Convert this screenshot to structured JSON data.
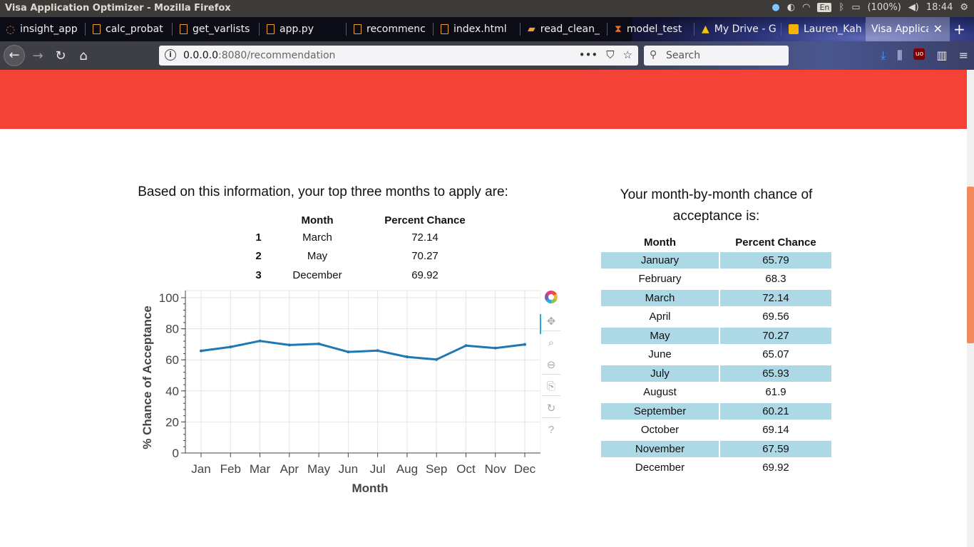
{
  "system": {
    "window_title": "Visa Application Optimizer - Mozilla Firefox",
    "lang": "En",
    "battery": "(100%)",
    "clock": "18:44"
  },
  "tabs": [
    {
      "label": "insight_app",
      "icon": "ubuntu-icon"
    },
    {
      "label": "calc_probat",
      "icon": "file-icon"
    },
    {
      "label": "get_varlists",
      "icon": "file-icon"
    },
    {
      "label": "app.py",
      "icon": "file-icon"
    },
    {
      "label": "recommenc",
      "icon": "file-icon"
    },
    {
      "label": "index.html",
      "icon": "file-icon"
    },
    {
      "label": "read_clean_",
      "icon": "notebook-icon"
    },
    {
      "label": "model_test",
      "icon": "hourglass-icon"
    },
    {
      "label": "My Drive - G",
      "icon": "drive-icon"
    },
    {
      "label": "Lauren_Kah",
      "icon": "slides-icon"
    },
    {
      "label": "Visa Applica",
      "icon": "none",
      "active": true
    }
  ],
  "nav": {
    "url_host": "0.0.0.0",
    "url_rest": ":8080/recommendation",
    "search_placeholder": "Search"
  },
  "page": {
    "top_heading": "Based on this information, your top three months to apply are:",
    "right_heading": "Your month-by-month chance of acceptance is:",
    "top3": {
      "headers": [
        "Month",
        "Percent Chance"
      ],
      "rows": [
        {
          "rank": "1",
          "month": "March",
          "pct": "72.14"
        },
        {
          "rank": "2",
          "month": "May",
          "pct": "70.27"
        },
        {
          "rank": "3",
          "month": "December",
          "pct": "69.92"
        }
      ]
    },
    "monthly": {
      "headers": [
        "Month",
        "Percent Chance"
      ],
      "rows": [
        {
          "month": "January",
          "pct": "65.79"
        },
        {
          "month": "February",
          "pct": "68.3"
        },
        {
          "month": "March",
          "pct": "72.14"
        },
        {
          "month": "April",
          "pct": "69.56"
        },
        {
          "month": "May",
          "pct": "70.27"
        },
        {
          "month": "June",
          "pct": "65.07"
        },
        {
          "month": "July",
          "pct": "65.93"
        },
        {
          "month": "August",
          "pct": "61.9"
        },
        {
          "month": "September",
          "pct": "60.21"
        },
        {
          "month": "October",
          "pct": "69.14"
        },
        {
          "month": "November",
          "pct": "67.59"
        },
        {
          "month": "December",
          "pct": "69.92"
        }
      ]
    }
  },
  "chart_data": {
    "type": "line",
    "categories": [
      "Jan",
      "Feb",
      "Mar",
      "Apr",
      "May",
      "Jun",
      "Jul",
      "Aug",
      "Sep",
      "Oct",
      "Nov",
      "Dec"
    ],
    "values": [
      65.79,
      68.3,
      72.14,
      69.56,
      70.27,
      65.07,
      65.93,
      61.9,
      60.21,
      69.14,
      67.59,
      69.92
    ],
    "xlabel": "Month",
    "ylabel": "% Chance of Acceptance",
    "ylim": [
      0,
      100
    ],
    "yticks": [
      0,
      20,
      40,
      60,
      80,
      100
    ],
    "grid": true,
    "line_color": "#1f77b4"
  }
}
